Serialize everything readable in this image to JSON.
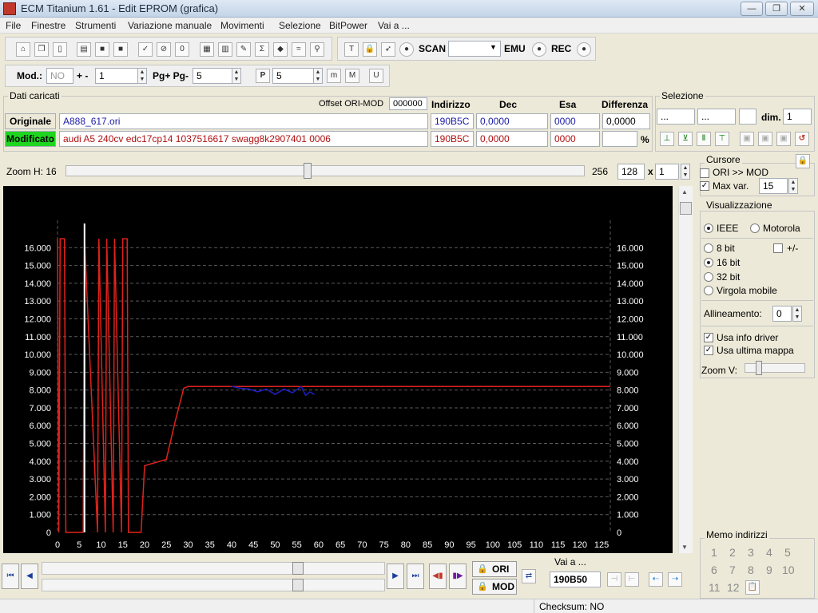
{
  "window": {
    "title": "ECM Titanium 1.61 - Edit EPROM (grafica)",
    "minimize_glyph": "—",
    "maximize_glyph": "❐",
    "close_glyph": "✕"
  },
  "menu": [
    "File",
    "Finestre",
    "Strumenti",
    "Variazione manuale",
    "Movimenti",
    "Selezione",
    "BitPower",
    "Vai a ..."
  ],
  "toolbar1": {
    "scan_label": "SCAN",
    "emu_label": "EMU",
    "rec_label": "REC",
    "scan_value": ""
  },
  "toolbar2": {
    "mod_label": "Mod.:",
    "mod_value": "NO",
    "plusminus_label": "+ -",
    "plusminus_value": "1",
    "pgpg_label": "Pg+ Pg-",
    "pgpg_value": "5",
    "p_label": "P",
    "p_value": "5",
    "m1_label": "m",
    "m2_label": "M",
    "u_label": "U"
  },
  "dati": {
    "title": "Dati caricati",
    "offset_label": "Offset ORI-MOD",
    "offset_value": "000000",
    "col_indirizzo": "Indirizzo",
    "col_dec": "Dec",
    "col_esa": "Esa",
    "col_diff": "Differenza",
    "ori_label": "Originale",
    "ori_file": "A888_617.ori",
    "ori_addr": "190B5C",
    "ori_dec": "0,0000",
    "ori_esa": "0000",
    "ori_diff": "0,0000",
    "mod_label": "Modificato",
    "mod_file": "audi A5 240cv edc17cp14 1037516617 swagg8k2907401 0006",
    "mod_addr": "190B5C",
    "mod_dec": "0,0000",
    "mod_esa": "0000",
    "mod_diff": "",
    "percent": "%"
  },
  "selezione": {
    "title": "Selezione",
    "field1": "...",
    "field2": "...",
    "field3": "",
    "dim_label": "dim.",
    "dim_value": "1"
  },
  "zoom": {
    "label": "Zoom H: 16",
    "value_256": "256",
    "field_128": "128",
    "x_label": "x",
    "field_1": "1"
  },
  "cursore": {
    "title": "Cursore",
    "ori_mod_label": "ORI >> MOD",
    "ori_mod_checked": false,
    "maxvar_label": "Max var.",
    "maxvar_checked": true,
    "maxvar_value": "15"
  },
  "visualizzazione": {
    "title": "Visualizzazione",
    "ieee": "IEEE",
    "motorola": "Motorola",
    "bit8": "8 bit",
    "plusminus": "+/-",
    "bit16": "16 bit",
    "bit32": "32 bit",
    "virgola": "Virgola mobile",
    "allineamento_label": "Allineamento:",
    "allineamento_value": "0",
    "usa_info_driver": "Usa info driver",
    "usa_ultima_mappa": "Usa ultima mappa",
    "zoom_v": "Zoom V:"
  },
  "memo": {
    "title": "Memo indirizzi",
    "slots": [
      "1",
      "2",
      "3",
      "4",
      "5",
      "6",
      "7",
      "8",
      "9",
      "10",
      "11",
      "12"
    ]
  },
  "bottom": {
    "ori_btn": "ORI",
    "mod_btn": "MOD",
    "vai_label": "Vai a ...",
    "vai_value": "190B50"
  },
  "status": {
    "checksum": "Checksum: NO"
  },
  "colors": {
    "ori_series": "#1e1ec8",
    "mod_series": "#e0221c",
    "cursor": "#ffffff",
    "modificato_bg": "#1fd51f",
    "grid": "#5a5a5a"
  },
  "chart_data": {
    "type": "line",
    "x_ticks": [
      0,
      5,
      10,
      15,
      20,
      25,
      30,
      35,
      40,
      45,
      50,
      55,
      60,
      65,
      70,
      75,
      80,
      85,
      90,
      95,
      100,
      105,
      110,
      115,
      120,
      125
    ],
    "y_ticks_left": [
      "0",
      "1.000",
      "2.000",
      "3.000",
      "4.000",
      "5.000",
      "6.000",
      "7.000",
      "8.000",
      "9.000",
      "10.000",
      "11.000",
      "12.000",
      "13.000",
      "14.000",
      "15.000",
      "16.000"
    ],
    "y_ticks_right": [
      "0",
      "1.000",
      "2.000",
      "3.000",
      "4.000",
      "5.000",
      "6.000",
      "7.000",
      "8.000",
      "9.000",
      "10.000",
      "11.000",
      "12.000",
      "13.000",
      "14.000",
      "15.000",
      "16.000"
    ],
    "xlim": [
      0,
      127
    ],
    "ylim": [
      0,
      17000
    ],
    "grid": true,
    "cursor_x": 6.2,
    "series": [
      {
        "values": [
          [
            0,
            16500
          ],
          [
            0.3,
            0
          ],
          [
            0.6,
            16500
          ],
          [
            1.6,
            16500
          ],
          [
            1.9,
            0
          ],
          [
            5.9,
            0
          ],
          [
            6.2,
            16500
          ],
          [
            9.2,
            0
          ],
          [
            9.5,
            16500
          ],
          [
            11,
            0
          ],
          [
            11.3,
            16500
          ],
          [
            12.8,
            0
          ],
          [
            13.1,
            16500
          ],
          [
            14.7,
            0
          ],
          [
            15,
            16500
          ],
          [
            16,
            16500
          ],
          [
            16.3,
            0
          ],
          [
            19.2,
            0
          ],
          [
            20,
            3750
          ],
          [
            25,
            4100
          ],
          [
            27,
            6200
          ],
          [
            29,
            8100
          ],
          [
            30,
            8200
          ],
          [
            127,
            8200
          ]
        ]
      },
      {
        "values": [
          [
            40,
            8200
          ],
          [
            42,
            8100
          ],
          [
            44,
            8050
          ],
          [
            46,
            7900
          ],
          [
            48,
            8050
          ],
          [
            50,
            7750
          ],
          [
            52,
            8050
          ],
          [
            54,
            7850
          ],
          [
            56,
            8200
          ],
          [
            57,
            7700
          ],
          [
            58,
            7900
          ],
          [
            59,
            7750
          ]
        ]
      }
    ]
  }
}
